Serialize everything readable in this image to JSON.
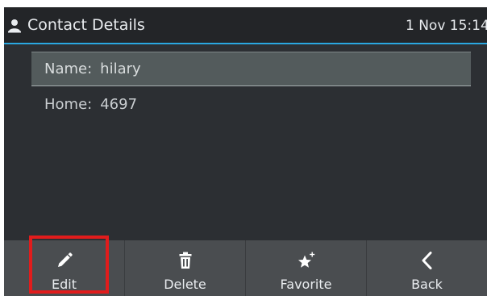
{
  "header": {
    "title": "Contact Details",
    "time": "1 Nov 15:14",
    "icon": "person-icon",
    "accent_color": "#2aa7e0"
  },
  "details": [
    {
      "label": "Name:",
      "value": "hilary",
      "selected": true
    },
    {
      "label": "Home:",
      "value": "4697",
      "selected": false
    }
  ],
  "softkeys": [
    {
      "label": "Edit",
      "icon": "pencil-icon"
    },
    {
      "label": "Delete",
      "icon": "trash-icon"
    },
    {
      "label": "Favorite",
      "icon": "star-plus-icon"
    },
    {
      "label": "Back",
      "icon": "chevron-left-icon"
    }
  ],
  "highlight": {
    "target": "Edit",
    "color": "#e11c1c"
  }
}
